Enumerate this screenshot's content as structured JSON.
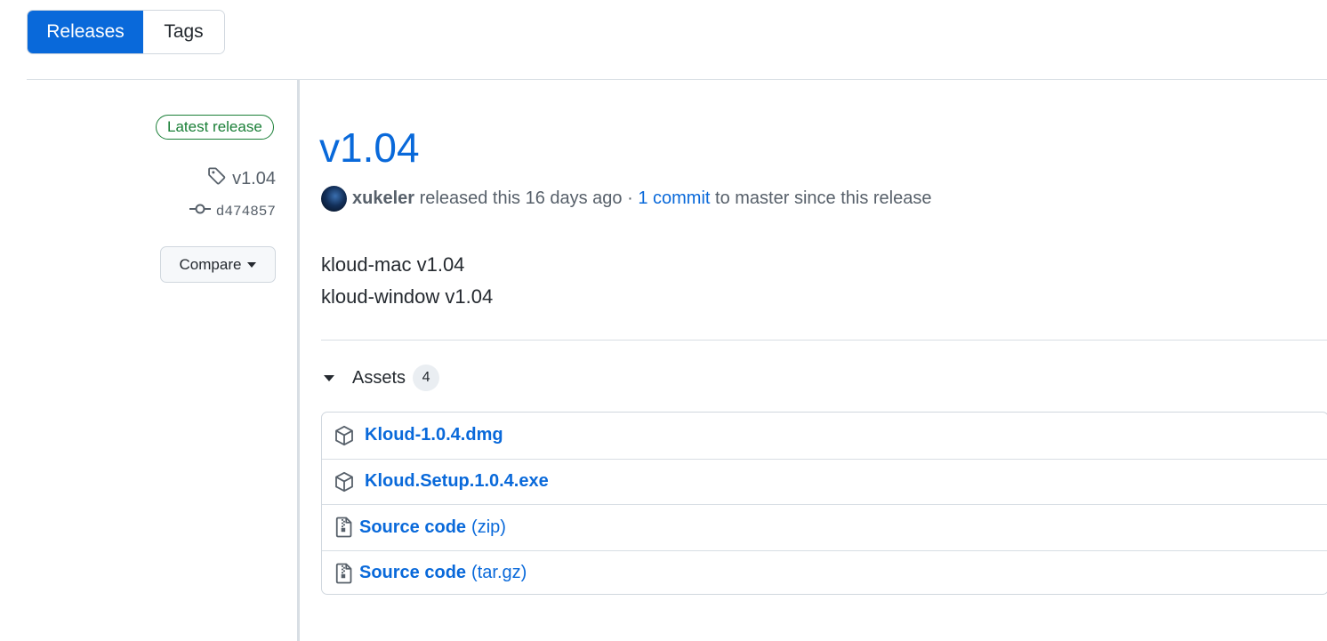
{
  "tabs": {
    "releases": "Releases",
    "tags": "Tags"
  },
  "sidebar": {
    "latest_badge": "Latest release",
    "tag": "v1.04",
    "commit": "d474857",
    "compare_label": "Compare"
  },
  "release": {
    "title": "v1.04",
    "author": "xukeler",
    "released_text": "released this 16 days ago ·",
    "commit_link": "1 commit",
    "since_text": "to master since this release",
    "notes": [
      "kloud-mac v1.04",
      "kloud-window v1.04"
    ]
  },
  "assets": {
    "heading": "Assets",
    "count": "4",
    "items": [
      {
        "name": "Kloud-1.0.4.dmg",
        "suffix": "",
        "icon": "package-icon"
      },
      {
        "name": "Kloud.Setup.1.0.4.exe",
        "suffix": "",
        "icon": "package-icon"
      },
      {
        "name": "Source code",
        "suffix": "(zip)",
        "icon": "file-zip-icon"
      },
      {
        "name": "Source code",
        "suffix": "(tar.gz)",
        "icon": "file-zip-icon"
      }
    ]
  },
  "colors": {
    "accent": "#0969da",
    "success": "#1a7f37",
    "muted_text": "#57606a",
    "border": "#d0d7de"
  }
}
